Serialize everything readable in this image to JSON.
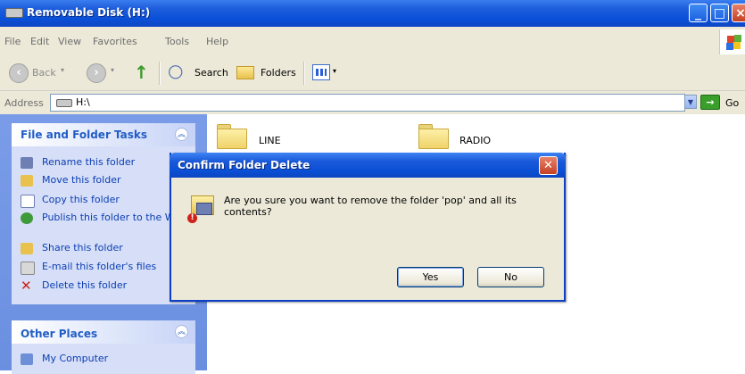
{
  "window": {
    "title": "Removable Disk (H:)"
  },
  "menu": [
    "File",
    "Edit",
    "View",
    "Favorites",
    "Tools",
    "Help"
  ],
  "toolbar": {
    "back": "Back",
    "search": "Search",
    "folders": "Folders"
  },
  "address": {
    "label": "Address",
    "value": "H:\\",
    "go": "Go"
  },
  "left_pane": {
    "tasks_title": "File and Folder Tasks",
    "tasks": [
      {
        "label": "Rename this folder",
        "icon": "rename-icon"
      },
      {
        "label": "Move this folder",
        "icon": "move-icon"
      },
      {
        "label": "Copy this folder",
        "icon": "copy-icon"
      },
      {
        "label": "Publish this folder to the Web",
        "icon": "globe-icon"
      },
      {
        "label": "Share this folder",
        "icon": "share-icon"
      },
      {
        "label": "E-mail this folder's files",
        "icon": "email-icon"
      },
      {
        "label": "Delete this folder",
        "icon": "delete-x-icon"
      }
    ],
    "places_title": "Other Places",
    "places": [
      {
        "label": "My Computer",
        "icon": "computer-icon"
      }
    ]
  },
  "folders": [
    {
      "name": "LINE"
    },
    {
      "name": "RADIO"
    }
  ],
  "dialog": {
    "title": "Confirm Folder Delete",
    "message": "Are you sure you want to remove the folder 'pop' and all its contents?",
    "yes": "Yes",
    "no": "No"
  },
  "colors": {
    "titlebar": "#0a50d8",
    "link": "#0c3db4",
    "pane": "#6b8fe0"
  }
}
